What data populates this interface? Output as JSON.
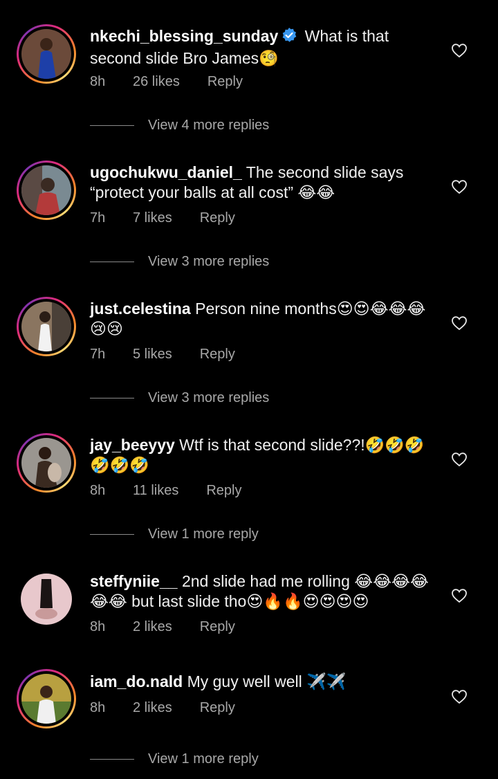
{
  "comments": [
    {
      "username": "nkechi_blessing_sunday",
      "verified": true,
      "text": " What is that second slide Bro James🧐",
      "time": "8h",
      "likes": "26 likes",
      "reply": "Reply",
      "view_more": "View 4 more replies"
    },
    {
      "username": "ugochukwu_daniel_",
      "text": " The second slide says “protect your balls at all cost” 😂😂",
      "time": "7h",
      "likes": "7 likes",
      "reply": "Reply",
      "view_more": "View 3 more replies"
    },
    {
      "username": "just.celestina",
      "text": " Person nine months😍😍😂😂😂😢😢",
      "time": "7h",
      "likes": "5 likes",
      "reply": "Reply",
      "view_more": "View 3 more replies"
    },
    {
      "username": "jay_beeyyy",
      "text": " Wtf is that second slide??!🤣🤣🤣🤣🤣🤣",
      "time": "8h",
      "likes": "11 likes",
      "reply": "Reply",
      "view_more": "View 1 more reply"
    },
    {
      "username": "steffyniie__",
      "text": " 2nd slide had me rolling 😂😂😂😂😂😂 but last slide tho😍🔥🔥😍😍😍😍",
      "time": "8h",
      "likes": "2 likes",
      "reply": "Reply"
    },
    {
      "username": "iam_do.nald",
      "text": " My guy well well ✈️✈️",
      "time": "8h",
      "likes": "2 likes",
      "reply": "Reply",
      "view_more": "View 1 more reply"
    }
  ],
  "colors": {
    "background": "#000000",
    "secondary_text": "#a8a8a8",
    "verified_blue": "#3897f0"
  }
}
